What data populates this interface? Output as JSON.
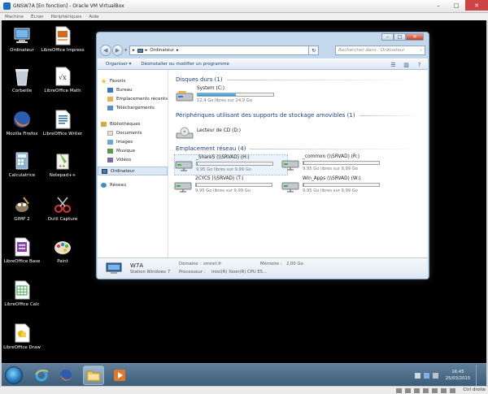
{
  "vbox": {
    "title": "GNSW7A [En fonction] - Oracle VM VirtualBox",
    "menu": [
      "Machine",
      "Écran",
      "Périphériques",
      "Aide"
    ],
    "host_key": "Ctrl droite"
  },
  "desktop": {
    "icons": [
      {
        "name": "Ordinateur",
        "icon": "computer-icon"
      },
      {
        "name": "LibreOffice Impress",
        "icon": "impress-icon"
      },
      {
        "name": "Corbeille",
        "icon": "recycle-bin-icon"
      },
      {
        "name": "LibreOffice Math",
        "icon": "math-icon"
      },
      {
        "name": "Mozilla Firefox",
        "icon": "firefox-icon"
      },
      {
        "name": "LibreOffice Writer",
        "icon": "writer-icon"
      },
      {
        "name": "Calculatrice",
        "icon": "calculator-icon"
      },
      {
        "name": "Notepad++",
        "icon": "notepadpp-icon"
      },
      {
        "name": "GIMP 2",
        "icon": "gimp-icon"
      },
      {
        "name": "Outil Capture",
        "icon": "snipping-tool-icon"
      },
      {
        "name": "LibreOffice Base",
        "icon": "base-icon"
      },
      {
        "name": "Paint",
        "icon": "paint-icon"
      },
      {
        "name": "LibreOffice Calc",
        "icon": "calc-icon"
      },
      {
        "name": "LibreOffice Draw",
        "icon": "draw-icon"
      }
    ]
  },
  "explorer": {
    "address": "Ordinateur",
    "search_placeholder": "Rechercher dans : Ordinateur",
    "toolbar": {
      "organize": "Organiser ▾",
      "uninstall": "Désinstaller ou modifier un programme"
    },
    "nav_pane": {
      "favorites": "Favoris",
      "desktop": "Bureau",
      "recent": "Emplacements récents",
      "downloads": "Téléchargements",
      "libraries": "Bibliothèques",
      "documents": "Documents",
      "images": "Images",
      "music": "Musique",
      "videos": "Vidéos",
      "computer": "Ordinateur",
      "network": "Réseau"
    },
    "groups": {
      "hard_disks": "Disques durs (1)",
      "removable": "Périphériques utilisant des supports de stockage amovibles (1)",
      "network": "Emplacement réseau (4)"
    },
    "drives": {
      "system": {
        "name": "System (C:)",
        "free": "12,4 Go libres sur 24,9 Go",
        "used_fraction": 0.5
      },
      "cd": {
        "name": "Lecteur de CD (D:)"
      },
      "shared": {
        "name": "_ShareS (\\\\SRVAD) (H:)",
        "free": "9,95 Go libres sur 9,99 Go",
        "used_fraction": 0.004
      },
      "common": {
        "name": "_common (\\\\SRVAD) (R:)",
        "free": "9,95 Go libres sur 9,99 Go",
        "used_fraction": 0.004
      },
      "sysvol": {
        "name": "2CYCS (\\\\SRVAD) (T:)",
        "free": "9,95 Go libres sur 9,99 Go",
        "used_fraction": 0.004
      },
      "apps": {
        "name": "Win_Apps (\\\\SRVAD) (W:)",
        "free": "9,95 Go libres sur 9,99 Go",
        "used_fraction": 0.004
      }
    },
    "details": {
      "name": "W7A",
      "domain_label": "Domaine :",
      "domain": "smnet.fr",
      "memory_label": "Mémoire :",
      "memory": "2,00 Go",
      "workstation": "Station Windows 7",
      "processor_label": "Processeur :",
      "processor": "Intel(R) Xeon(R) CPU E5..."
    }
  },
  "taskbar": {
    "time": "16:45",
    "date": "25/03/2015"
  },
  "colors": {
    "accent": "#2595d6",
    "taskbar": "#4b6b88",
    "window_frame": "#c3d8ec"
  }
}
